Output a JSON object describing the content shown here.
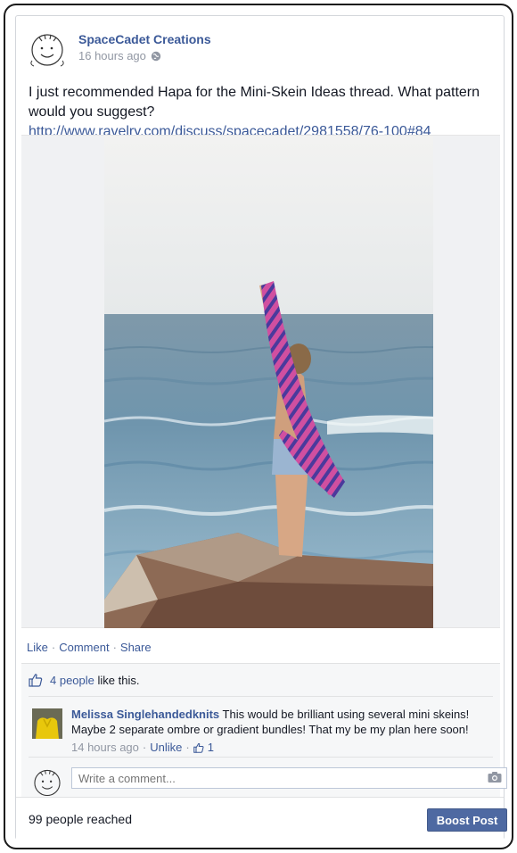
{
  "post": {
    "author": "SpaceCadet Creations",
    "time": "16 hours ago",
    "text": "I just recommended Hapa for the Mini-Skein Ideas thread. What pattern would you suggest?",
    "link": "http://www.ravelry.com/discuss/spacecadet/2981558/76-100#84"
  },
  "actions": {
    "like": "Like",
    "comment": "Comment",
    "share": "Share",
    "sep": "·"
  },
  "likes": {
    "count_text": "4 people",
    "suffix": "like this."
  },
  "comment": {
    "author": "Melissa Singlehandedknits",
    "text": "This would be brilliant using several mini skeins! Maybe 2 separate ombre or gradient bundles! That my be my plan here soon!",
    "time": "14 hours ago",
    "unlike": "Unlike",
    "like_count": "1",
    "sep": "·"
  },
  "comment_box": {
    "placeholder": "Write a comment..."
  },
  "footer": {
    "reached": "99 people reached",
    "boost": "Boost Post"
  },
  "colors": {
    "link_blue": "#3b5998",
    "boost_bg": "#4e69a2",
    "meta_grey": "#9197a3"
  },
  "icons": [
    "globe-icon",
    "thumbs-up-icon",
    "camera-icon",
    "avatar-doodle"
  ]
}
